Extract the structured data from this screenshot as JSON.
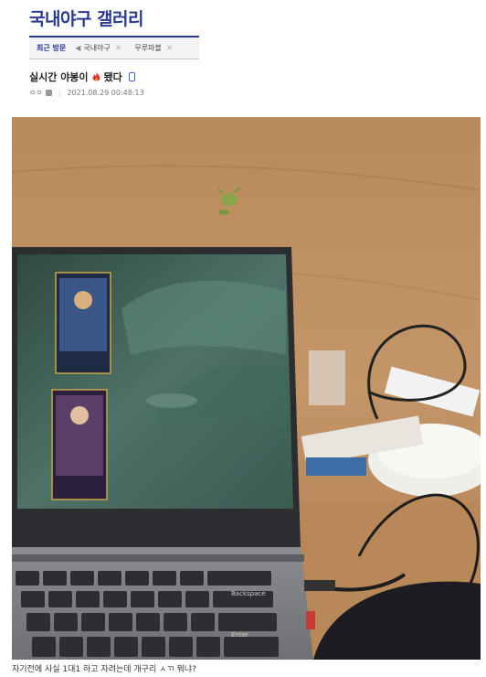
{
  "gallery": {
    "title": "국내야구 갤러리"
  },
  "recent": {
    "label": "최근 방문",
    "items": [
      {
        "label": "국내야구"
      },
      {
        "label": "무루마블"
      }
    ],
    "close_glyph": "×"
  },
  "post": {
    "title_prefix": "실시간 야봉이",
    "title_suffix": "됐다",
    "author": "ㅇㅇ",
    "date": "2021.08.29 00:48:13",
    "caption": "자기전에 사실 1대1 하고 자려는데 개구리 ㅅㄲ 뭐냐?"
  },
  "photo": {
    "keys": [
      "Backspace",
      "Enter"
    ]
  },
  "colors": {
    "brand": "#2b3a8f",
    "link": "#3a66c9"
  }
}
